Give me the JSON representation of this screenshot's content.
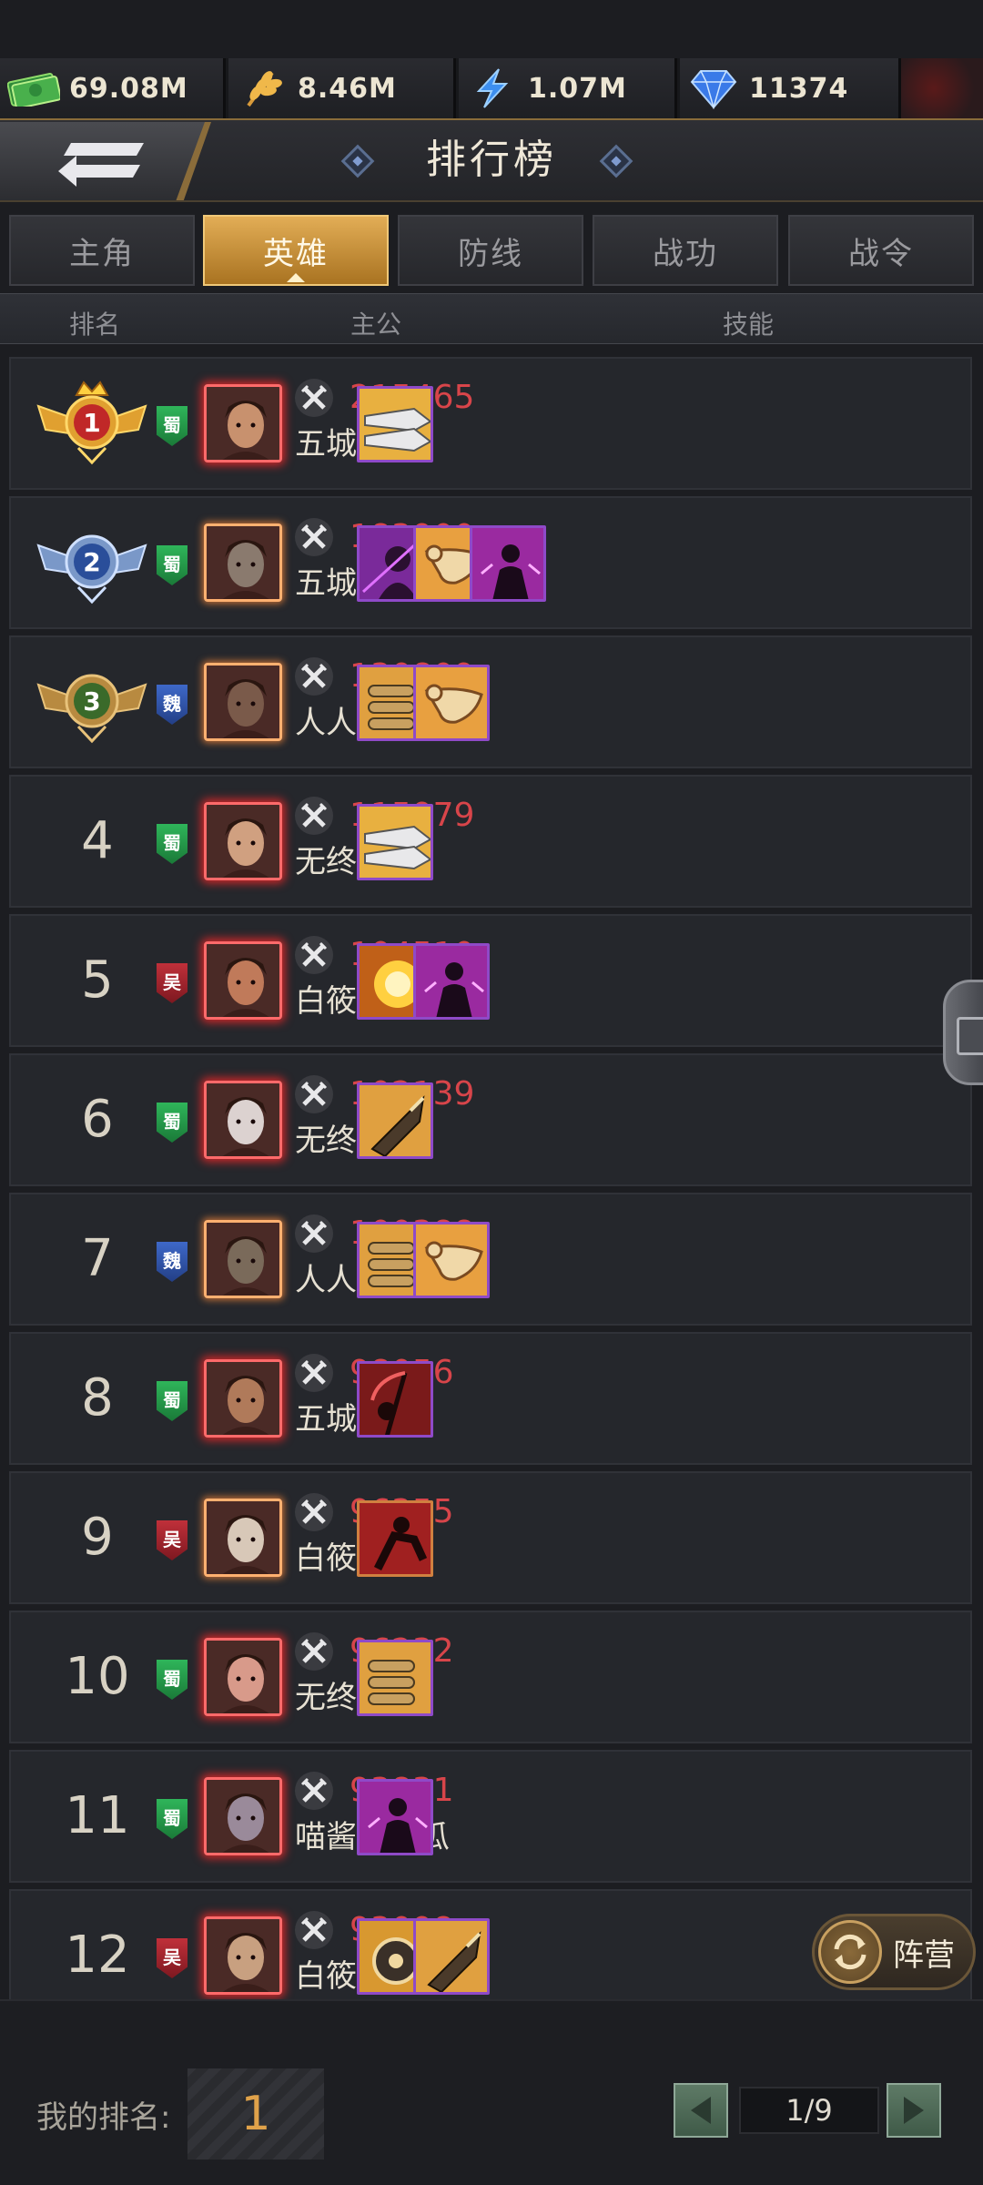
{
  "resources": [
    {
      "icon": "cash-icon",
      "value": "69.08M"
    },
    {
      "icon": "wheat-icon",
      "value": "8.46M"
    },
    {
      "icon": "energy-icon",
      "value": "1.07M"
    },
    {
      "icon": "diamond-icon",
      "value": "11374"
    }
  ],
  "header": {
    "title": "排行榜"
  },
  "tabs": [
    {
      "label": "主角",
      "active": false
    },
    {
      "label": "英雄",
      "active": true
    },
    {
      "label": "防线",
      "active": false
    },
    {
      "label": "战功",
      "active": false
    },
    {
      "label": "战令",
      "active": false
    }
  ],
  "columns": {
    "rank": "排名",
    "lord": "主公",
    "skills": "技能"
  },
  "rows": [
    {
      "rank": "1",
      "faction": "蜀",
      "power": "215465",
      "name": "五城孟守",
      "skills": [
        "blade-skill"
      ]
    },
    {
      "rank": "2",
      "faction": "蜀",
      "power": "183900",
      "name": "五城孟守",
      "skills": [
        "shadow-skill",
        "horn-skill",
        "rage-skill"
      ]
    },
    {
      "rank": "3",
      "faction": "魏",
      "power": "130809",
      "name": "人人人",
      "skills": [
        "bullets-skill",
        "horn-skill"
      ]
    },
    {
      "rank": "4",
      "faction": "蜀",
      "power": "115979",
      "name": "无终大楚",
      "skills": [
        "blade-skill"
      ]
    },
    {
      "rank": "5",
      "faction": "吴",
      "power": "104510",
      "name": "白筱筱丶",
      "skills": [
        "explosion-skill",
        "rage-skill"
      ]
    },
    {
      "rank": "6",
      "faction": "蜀",
      "power": "102139",
      "name": "无终大楚",
      "skills": [
        "shell-skill"
      ]
    },
    {
      "rank": "7",
      "faction": "魏",
      "power": "100388",
      "name": "人人人",
      "skills": [
        "bullets-skill",
        "horn-skill"
      ]
    },
    {
      "rank": "8",
      "faction": "蜀",
      "power": "98056",
      "name": "五城孟守",
      "skills": [
        "scythe-skill"
      ]
    },
    {
      "rank": "9",
      "faction": "吴",
      "power": "96355",
      "name": "白筱筱丶",
      "skills": [
        "fighter-skill"
      ]
    },
    {
      "rank": "10",
      "faction": "蜀",
      "power": "96232",
      "name": "无终大楚",
      "skills": [
        "bullets-skill"
      ]
    },
    {
      "rank": "11",
      "faction": "蜀",
      "power": "93831",
      "name": "喵酱吃西瓜",
      "skills": [
        "rage-skill"
      ]
    },
    {
      "rank": "12",
      "faction": "吴",
      "power": "93098",
      "name": "白筱筱丶",
      "skills": [
        "gear-skill",
        "shell-skill"
      ]
    }
  ],
  "camp_button": {
    "label": "阵营"
  },
  "footer": {
    "my_rank_label": "我的排名:",
    "my_rank_value": "1",
    "page": "1/9"
  },
  "colors": {
    "accent_gold": "#e2ad56",
    "power_red": "#d8454a",
    "shu": "#2fb55a",
    "wei": "#3e68c8",
    "wu": "#c0303a"
  }
}
